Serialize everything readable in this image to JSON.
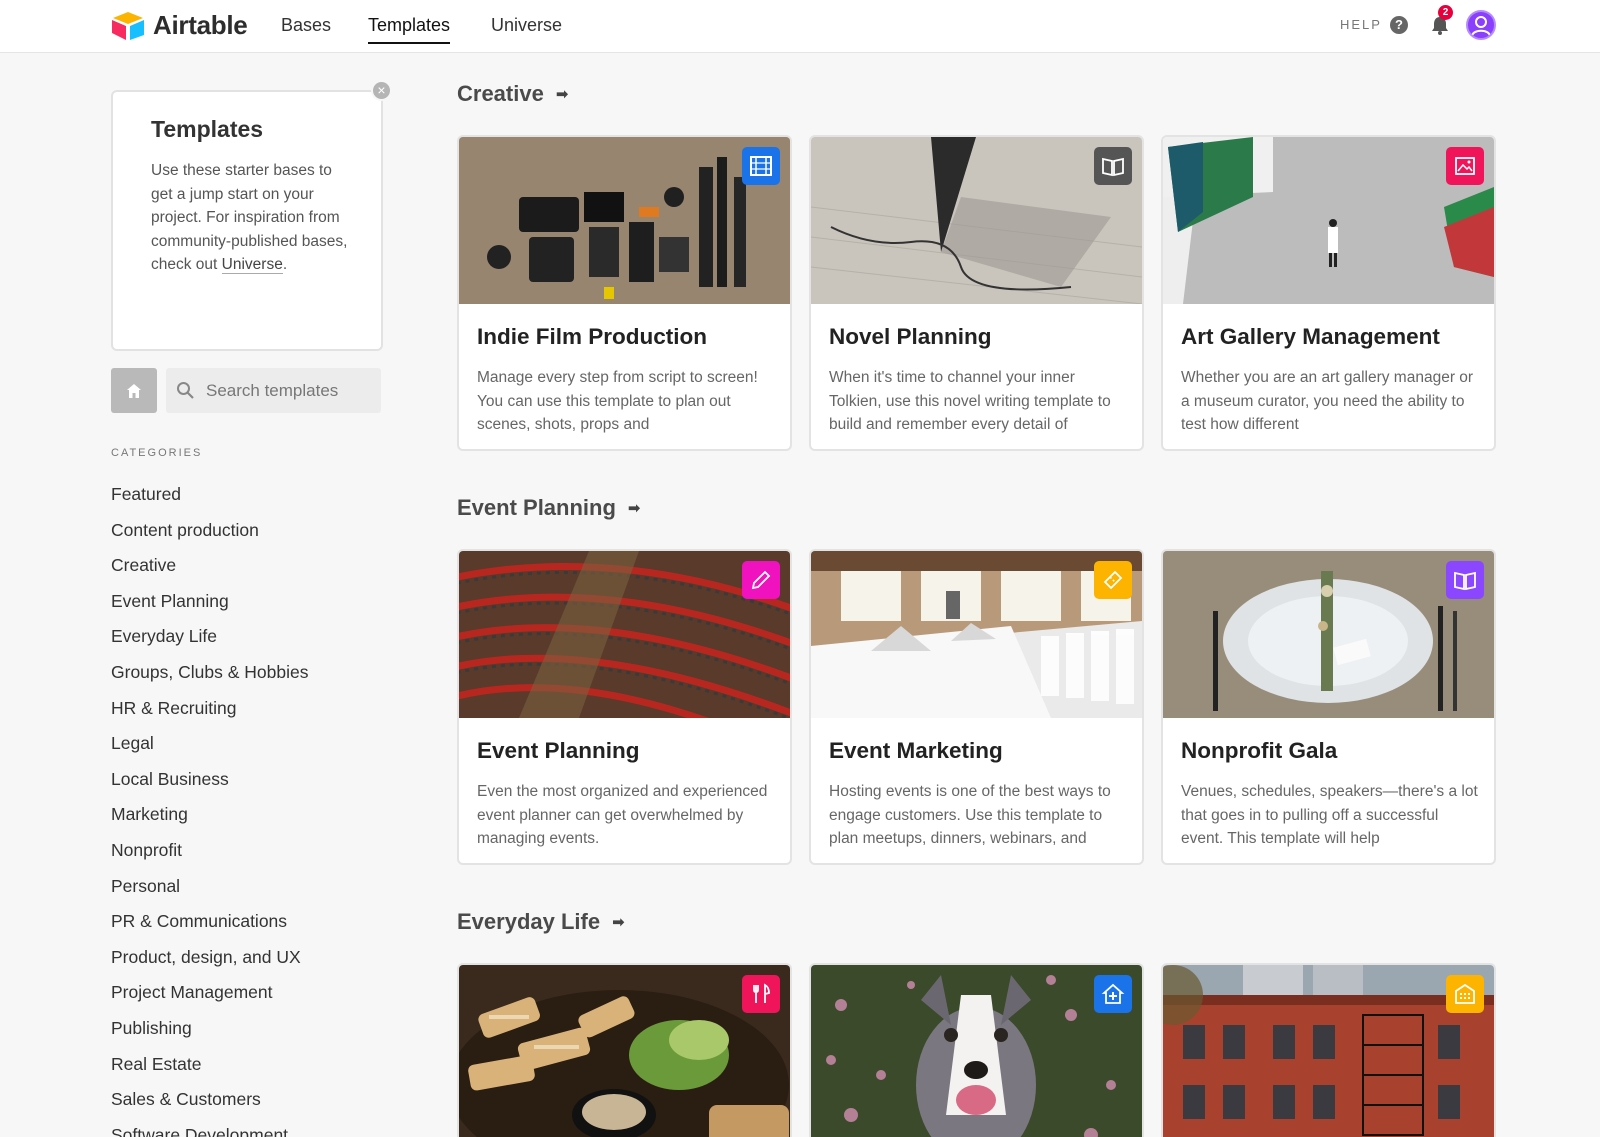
{
  "app": {
    "name": "Airtable"
  },
  "nav": {
    "items": [
      "Bases",
      "Templates",
      "Universe"
    ],
    "active": "Templates"
  },
  "header": {
    "help_label": "HELP",
    "notification_count": "2"
  },
  "sidebar": {
    "intro": {
      "title": "Templates",
      "text": "Use these starter bases to get a jump start on your project. For inspiration from community-published bases, check out ",
      "link": "Universe",
      "text_end": "."
    },
    "search_placeholder": "Search templates",
    "categories_heading": "CATEGORIES",
    "categories": [
      "Featured",
      "Content production",
      "Creative",
      "Event Planning",
      "Everyday Life",
      "Groups, Clubs & Hobbies",
      "HR & Recruiting",
      "Legal",
      "Local Business",
      "Marketing",
      "Nonprofit",
      "Personal",
      "PR & Communications",
      "Product, design, and UX",
      "Project Management",
      "Publishing",
      "Real Estate",
      "Sales & Customers",
      "Software Development"
    ]
  },
  "sections": [
    {
      "title": "Creative",
      "cards": [
        {
          "title": "Indie Film Production",
          "desc": "Manage every step from script to screen! You can use this template to plan out scenes, shots, props and",
          "icon": "film-icon",
          "color": "#1a73e8"
        },
        {
          "title": "Novel Planning",
          "desc": "When it's time to channel your inner Tolkien, use this novel writing template to build and remember every detail of",
          "icon": "book-icon",
          "color": "#555555"
        },
        {
          "title": "Art Gallery Management",
          "desc": "Whether you are an art gallery manager or a museum curator, you need the ability to test how different",
          "icon": "picture-icon",
          "color": "#f0155b"
        }
      ]
    },
    {
      "title": "Event Planning",
      "cards": [
        {
          "title": "Event Planning",
          "desc": "Even the most organized and experienced event planner can get overwhelmed by managing events.",
          "icon": "pencil-icon",
          "color": "#f012be"
        },
        {
          "title": "Event Marketing",
          "desc": "Hosting events is one of the best ways to engage customers. Use this template to plan meetups, dinners, webinars, and",
          "icon": "ticket-icon",
          "color": "#fcb400"
        },
        {
          "title": "Nonprofit Gala",
          "desc": "Venues, schedules, speakers—there's a lot that goes in to pulling off a successful event. This template will help",
          "icon": "book-icon",
          "color": "#8b46ff"
        }
      ]
    },
    {
      "title": "Everyday Life",
      "cards": [
        {
          "title": "",
          "desc": "",
          "icon": "utensils-icon",
          "color": "#f0155b"
        },
        {
          "title": "",
          "desc": "",
          "icon": "vet-icon",
          "color": "#1a73e8"
        },
        {
          "title": "",
          "desc": "",
          "icon": "building-icon",
          "color": "#fcb400"
        }
      ]
    }
  ]
}
